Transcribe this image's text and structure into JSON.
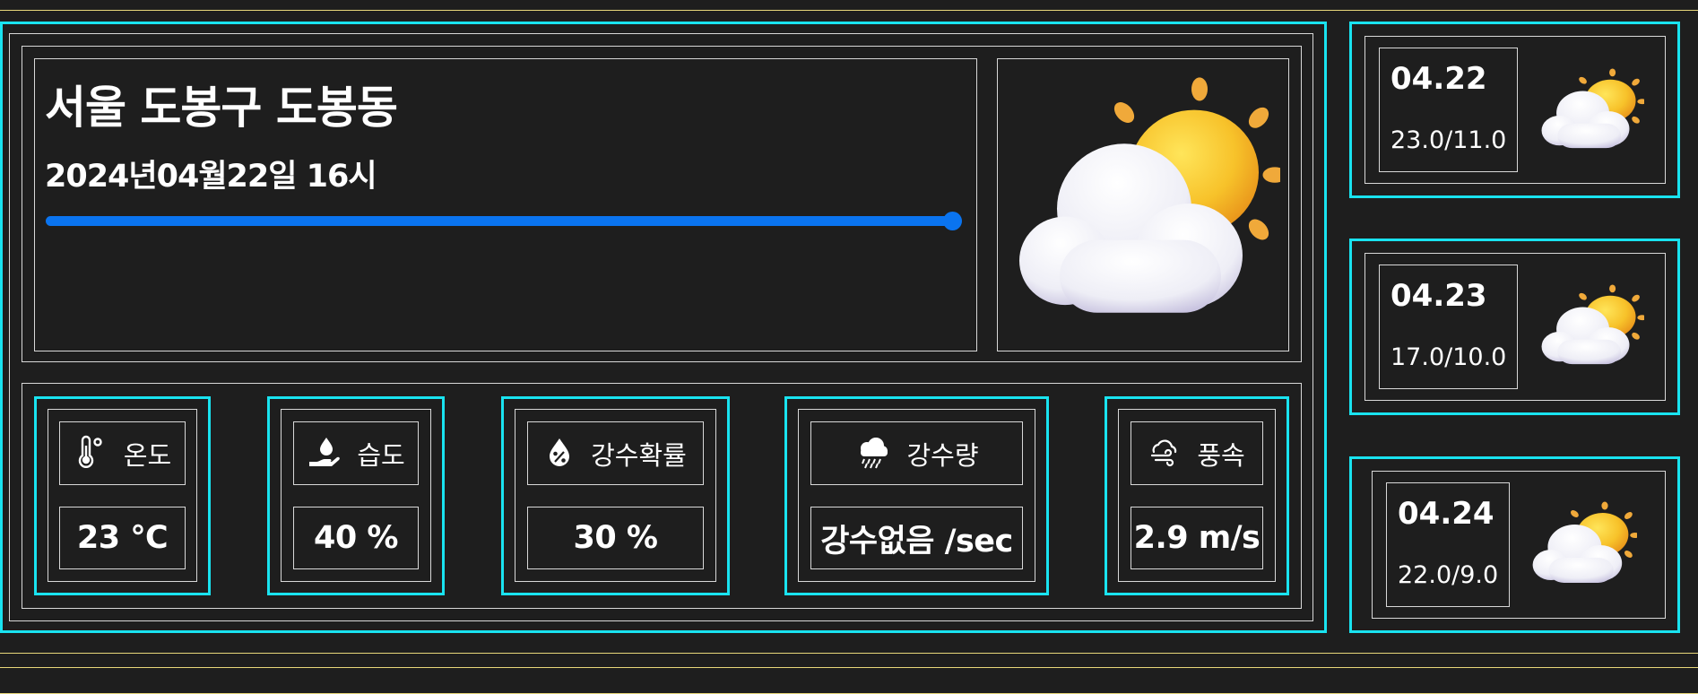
{
  "current": {
    "location": "서울 도봉구 도봉동",
    "datetime": "2024년04월22일 16시",
    "progress": 1.0,
    "weather_icon": "sun-behind-cloud-icon"
  },
  "metrics": [
    {
      "icon": "thermometer-icon",
      "label": "온도",
      "value": "23 ℃"
    },
    {
      "icon": "humidity-hand-drop-icon",
      "label": "습도",
      "value": "40 %"
    },
    {
      "icon": "rain-probability-drop-icon",
      "label": "강수확률",
      "value": "30 %"
    },
    {
      "icon": "rain-cloud-icon",
      "label": "강수량",
      "value": "강수없음 /sec"
    },
    {
      "icon": "wind-cloud-icon",
      "label": "풍속",
      "value": "2.9 m/s"
    }
  ],
  "forecast": [
    {
      "date": "04.22",
      "range": "23.0/11.0",
      "icon": "sun-behind-cloud-icon"
    },
    {
      "date": "04.23",
      "range": "17.0/10.0",
      "icon": "sun-behind-cloud-icon"
    },
    {
      "date": "04.24",
      "range": "22.0/9.0",
      "icon": "sun-behind-cloud-icon"
    }
  ],
  "colors": {
    "accent_border": "#19e3f0",
    "progress_bar": "#0a74f0",
    "outer_border": "#e8d77a",
    "background": "#1e1e1e"
  }
}
